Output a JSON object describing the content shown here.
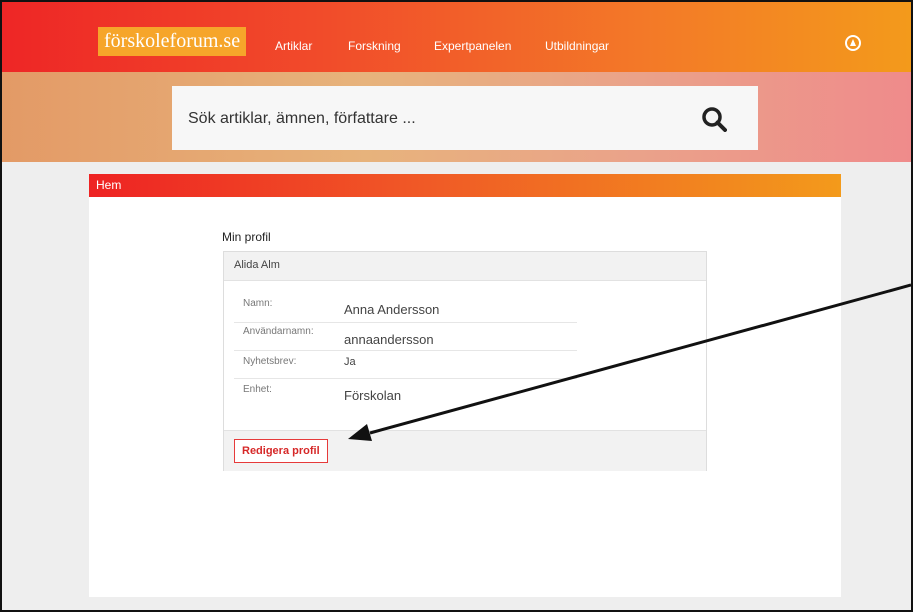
{
  "header": {
    "logo": "förskoleforum.se",
    "nav": [
      "Artiklar",
      "Forskning",
      "Expertpanelen",
      "Utbildningar"
    ]
  },
  "search": {
    "placeholder": "Sök artiklar, ämnen, författare ..."
  },
  "breadcrumb": {
    "home": "Hem"
  },
  "profile": {
    "title": "Min profil",
    "card_title": "Alida Alm",
    "fields": [
      {
        "label": "Namn:",
        "value": "Anna Andersson"
      },
      {
        "label": "Användarnamn:",
        "value": "annaandersson"
      },
      {
        "label": "Nyhetsbrev:",
        "value": "Ja"
      },
      {
        "label": "Enhet:",
        "value": "Förskolan"
      }
    ],
    "edit_button": "Redigera profil"
  },
  "colors": {
    "accent_red": "#ee2626",
    "accent_orange": "#f39a1b"
  }
}
